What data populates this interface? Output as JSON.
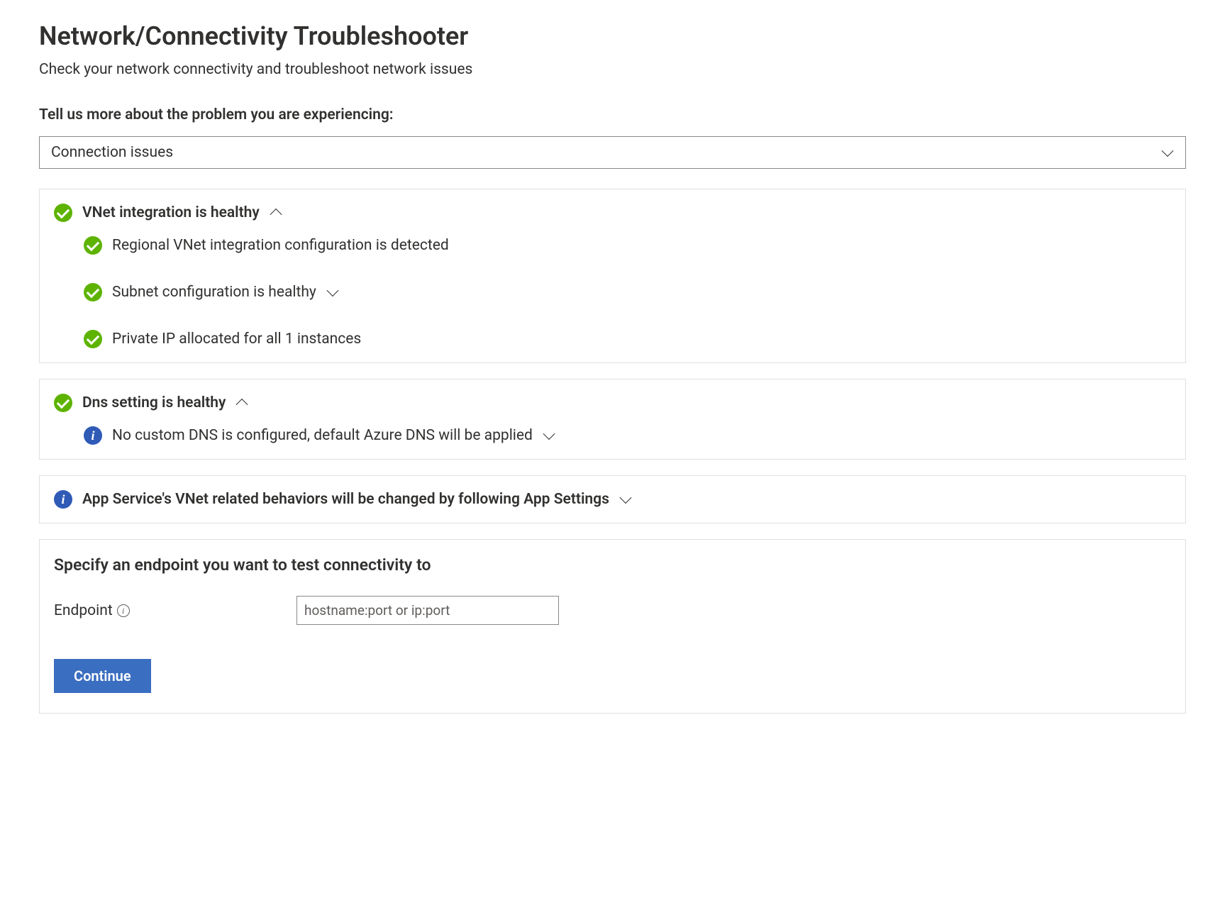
{
  "header": {
    "title": "Network/Connectivity Troubleshooter",
    "subtitle": "Check your network connectivity and troubleshoot network issues"
  },
  "prompt": {
    "label": "Tell us more about the problem you are experiencing:",
    "selected_value": "Connection issues"
  },
  "panels": {
    "vnet": {
      "title": "VNet integration is healthy",
      "items": [
        {
          "label": "Regional VNet integration configuration is detected"
        },
        {
          "label": "Subnet configuration is healthy"
        },
        {
          "label": "Private IP allocated for all 1 instances"
        }
      ]
    },
    "dns": {
      "title": "Dns setting is healthy",
      "items": [
        {
          "label": "No custom DNS is configured, default Azure DNS will be applied"
        }
      ]
    },
    "appsettings": {
      "title": "App Service's VNet related behaviors will be changed by following App Settings"
    }
  },
  "endpoint": {
    "section_title": "Specify an endpoint you want to test connectivity to",
    "field_label": "Endpoint",
    "placeholder": "hostname:port or ip:port",
    "value": "",
    "button_label": "Continue"
  }
}
